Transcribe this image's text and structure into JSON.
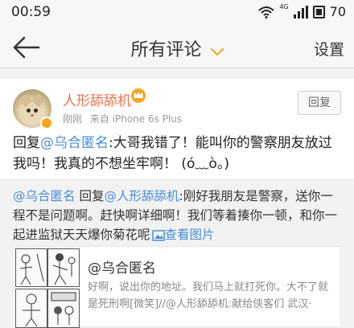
{
  "status": {
    "time": "00:59",
    "network": "4G",
    "battery": "70"
  },
  "nav": {
    "title": "所有评论",
    "settings": "设置"
  },
  "comment": {
    "username": "人形舔舔机",
    "time": "刚刚",
    "source": "来自 iPhone 6s Plus",
    "reply_button": "回复",
    "prefix": "回复",
    "mention": "@乌合匿名",
    "text": ":大哥我错了！能叫你的警察朋友放过我吗！我真的不想坐牢啊！ (ó﹏ò。)"
  },
  "quote": {
    "mention1": "@乌合匿名",
    "prefix": " 回复",
    "mention2": "@人形舔舔机",
    "text": ":刚好我朋友是警察，送你一程不是问题啊。赶快啊详细啊！我们等着揍你一顿，和你一起进监狱天天爆你菊花呢",
    "view_pic": "查看图片"
  },
  "share": {
    "title": "@乌合匿名",
    "desc": "好啊，说出你的地址。我们马上就打死你。大不了就是死刑啊[微笑]//@人形舔舔机:献给侠客们 武汉·"
  },
  "colors": {
    "accent": "#eb7350",
    "link": "#4a8ed6"
  }
}
